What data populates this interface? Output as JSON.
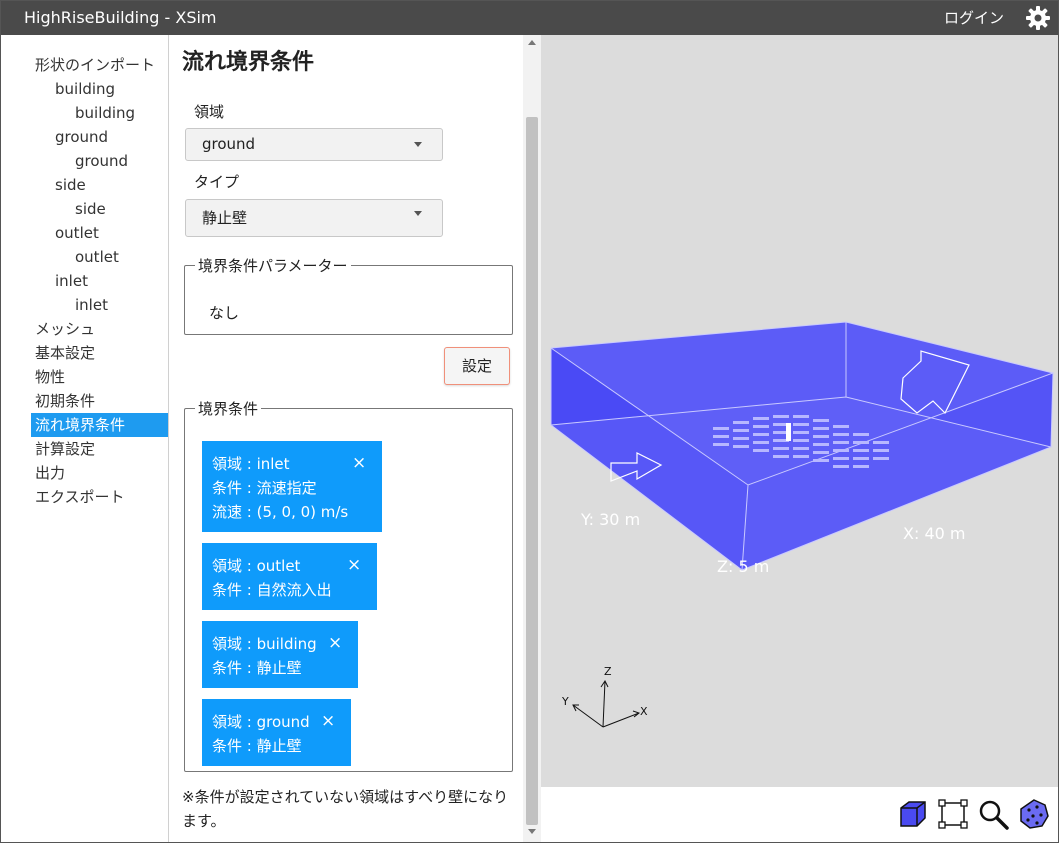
{
  "titlebar": {
    "title": "HighRiseBuilding - XSim",
    "login": "ログイン"
  },
  "nav": {
    "items": [
      {
        "label": "形状のインポート"
      },
      {
        "label": "building"
      },
      {
        "label": "building"
      },
      {
        "label": "ground"
      },
      {
        "label": "ground"
      },
      {
        "label": "side"
      },
      {
        "label": "side"
      },
      {
        "label": "outlet"
      },
      {
        "label": "outlet"
      },
      {
        "label": "inlet"
      },
      {
        "label": "inlet"
      },
      {
        "label": "メッシュ"
      },
      {
        "label": "基本設定"
      },
      {
        "label": "物性"
      },
      {
        "label": "初期条件"
      },
      {
        "label": "流れ境界条件"
      },
      {
        "label": "計算設定"
      },
      {
        "label": "出力"
      },
      {
        "label": "エクスポート"
      }
    ],
    "active": "流れ境界条件"
  },
  "panel": {
    "title": "流れ境界条件",
    "region_label": "領域",
    "region_value": "ground",
    "type_label": "タイプ",
    "type_value": "静止壁",
    "params_legend": "境界条件パラメーター",
    "params_value": "なし",
    "set_button": "設定",
    "conditions_legend": "境界条件",
    "close_glyph": "×",
    "conditions": [
      {
        "lines": [
          "領域 : inlet",
          "条件 : 流速指定",
          "流速 : (5, 0, 0) m/s"
        ]
      },
      {
        "lines": [
          "領域 : outlet",
          "条件 : 自然流入出"
        ]
      },
      {
        "lines": [
          "領域 : building",
          "条件 : 静止壁"
        ]
      },
      {
        "lines": [
          "領域 : ground",
          "条件 : 静止壁"
        ]
      }
    ],
    "note": "※条件が設定されていない領域はすべり壁になります。"
  },
  "viewport": {
    "box_color": "#5c5cf7",
    "labels": {
      "y": "Y: 30 m",
      "x": "X: 40 m",
      "z": "Z: 5 m"
    },
    "axes": {
      "z": "Z",
      "y": "Y",
      "x": "X"
    }
  },
  "toolbar": {
    "icons": [
      "box-view-icon",
      "fit-view-icon",
      "zoom-icon",
      "rotate-view-icon"
    ]
  }
}
